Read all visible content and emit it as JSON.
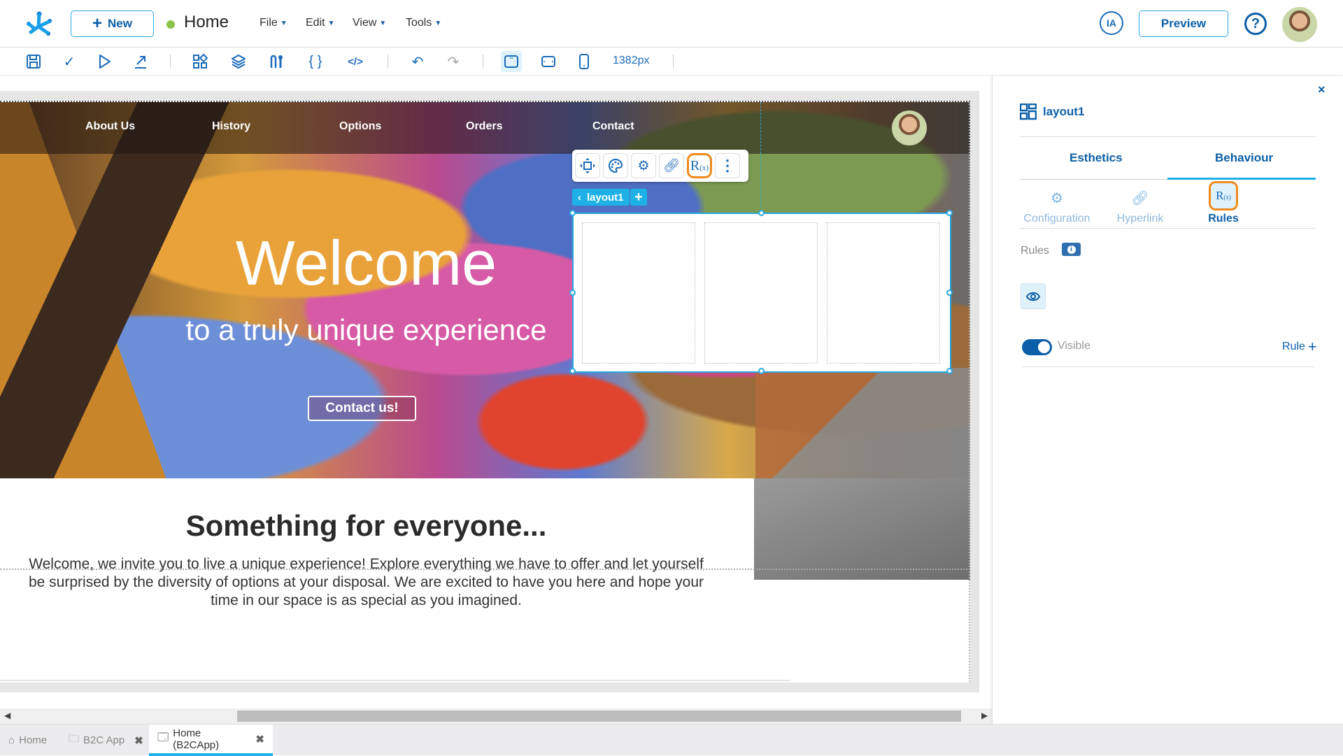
{
  "header": {
    "new_label": "New",
    "page_title": "Home",
    "menus": [
      {
        "label": "File"
      },
      {
        "label": "Edit"
      },
      {
        "label": "View"
      },
      {
        "label": "Tools"
      }
    ],
    "ia_label": "IA",
    "preview_label": "Preview",
    "help_label": "?",
    "status_color": "#8bc34a",
    "accent_color": "#0b5fa8"
  },
  "toolbar": {
    "width_readout": "1382px",
    "icons": [
      "save-icon",
      "check-icon",
      "play-icon",
      "export-icon",
      "components-icon",
      "layers-icon",
      "variables-icon",
      "braces-icon",
      "code-icon",
      "undo-icon",
      "redo-icon",
      "desktop-view-icon",
      "tablet-view-icon",
      "mobile-view-icon"
    ]
  },
  "canvas": {
    "nav_links": [
      "About Us",
      "History",
      "Options",
      "Orders",
      "Contact"
    ],
    "hero_title": "Welcome",
    "hero_subtitle": "to a truly unique experience",
    "contact_button": "Contact us!",
    "section_title": "Something for everyone...",
    "section_body": "Welcome, we invite you to live a unique experience! Explore everything we have to offer and let yourself be surprised by the diversity of options at your disposal. We are excited to have you here and hope your time in our space is as special as you imagined.",
    "selected_component": "layout1",
    "layout_columns": 3,
    "float_toolbar": [
      "move-icon",
      "palette-icon",
      "settings-icon",
      "link-icon",
      "rules-icon",
      "more-icon"
    ],
    "rules_glyph": "R",
    "rules_sub": "(x)"
  },
  "panel": {
    "close": "×",
    "title": "layout1",
    "tabs": [
      {
        "label": "Esthetics",
        "active": false
      },
      {
        "label": "Behaviour",
        "active": true
      }
    ],
    "sub_tabs": [
      {
        "label": "Configuration",
        "active": false
      },
      {
        "label": "Hyperlink",
        "active": false
      },
      {
        "label": "Rules",
        "active": true
      }
    ],
    "rules_label": "Rules",
    "info_glyph": "i",
    "visible_label": "Visible",
    "visible_on": true,
    "rule_add_label": "Rule",
    "rule_add_plus": "+"
  },
  "bottom_tabs": [
    {
      "label": "Home",
      "icon": "home-icon",
      "closable": false,
      "active": false
    },
    {
      "label": "B2C App",
      "icon": "folder-icon",
      "closable": true,
      "active": false
    },
    {
      "label": "Home (B2CApp)",
      "icon": "page-icon",
      "closable": true,
      "active": true
    }
  ],
  "close_glyph": "✖",
  "plus_glyph": "+",
  "chev_glyph": "⌄",
  "back_glyph": "‹"
}
